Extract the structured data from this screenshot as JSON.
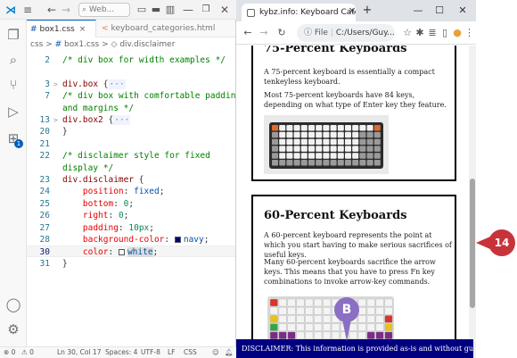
{
  "vscode": {
    "title_search": "Web...",
    "tabs": [
      {
        "icon": "#",
        "label": "box1.css",
        "close": "×"
      },
      {
        "icon": "<",
        "label": "keyboard_categories.html"
      }
    ],
    "breadcrumbs": {
      "folder": "css",
      "sep": ">",
      "file_icon": "#",
      "file": "box1.css",
      "sym_icon": "◇",
      "symbol": "div.disclaimer"
    },
    "extensions_badge": "1",
    "editor_lines": [
      {
        "n": "2",
        "fold": "",
        "tokens": [
          {
            "t": "/* div box for width examples */",
            "c": "comment"
          }
        ]
      },
      {
        "n": "",
        "fold": "",
        "tokens": []
      },
      {
        "n": "3",
        "fold": ">",
        "tokens": [
          {
            "t": "div.box",
            "c": "sel"
          },
          {
            "t": " {",
            "c": "punc"
          },
          {
            "t": "···",
            "c": "ellip"
          }
        ]
      },
      {
        "n": "7",
        "fold": "",
        "tokens": [
          {
            "t": "/* div box with comfortable padding",
            "c": "comment"
          }
        ]
      },
      {
        "n": "",
        "fold": "",
        "tokens": [
          {
            "t": "and margins */",
            "c": "comment"
          }
        ]
      },
      {
        "n": "13",
        "fold": ">",
        "tokens": [
          {
            "t": "div.box2",
            "c": "sel"
          },
          {
            "t": " {",
            "c": "punc"
          },
          {
            "t": "···",
            "c": "ellip"
          }
        ]
      },
      {
        "n": "20",
        "fold": "",
        "tokens": [
          {
            "t": "}",
            "c": "punc"
          }
        ]
      },
      {
        "n": "21",
        "fold": "",
        "tokens": []
      },
      {
        "n": "22",
        "fold": "",
        "tokens": [
          {
            "t": "/* disclaimer style for fixed",
            "c": "comment"
          }
        ]
      },
      {
        "n": "",
        "fold": "",
        "tokens": [
          {
            "t": "display */",
            "c": "comment"
          }
        ]
      },
      {
        "n": "23",
        "fold": "",
        "tokens": [
          {
            "t": "div.disclaimer",
            "c": "sel"
          },
          {
            "t": " {",
            "c": "punc"
          }
        ]
      },
      {
        "n": "24",
        "fold": "",
        "tokens": [
          {
            "t": "    position",
            "c": "prop"
          },
          {
            "t": ": ",
            "c": "punc"
          },
          {
            "t": "fixed",
            "c": "val"
          },
          {
            "t": ";",
            "c": "punc"
          }
        ]
      },
      {
        "n": "25",
        "fold": "",
        "tokens": [
          {
            "t": "    bottom",
            "c": "prop"
          },
          {
            "t": ": ",
            "c": "punc"
          },
          {
            "t": "0",
            "c": "num"
          },
          {
            "t": ";",
            "c": "punc"
          }
        ]
      },
      {
        "n": "26",
        "fold": "",
        "tokens": [
          {
            "t": "    right",
            "c": "prop"
          },
          {
            "t": ": ",
            "c": "punc"
          },
          {
            "t": "0",
            "c": "num"
          },
          {
            "t": ";",
            "c": "punc"
          }
        ]
      },
      {
        "n": "27",
        "fold": "",
        "tokens": [
          {
            "t": "    padding",
            "c": "prop"
          },
          {
            "t": ": ",
            "c": "punc"
          },
          {
            "t": "10px",
            "c": "num"
          },
          {
            "t": ";",
            "c": "punc"
          }
        ]
      },
      {
        "n": "28",
        "fold": "",
        "tokens": [
          {
            "t": "    background-color",
            "c": "prop"
          },
          {
            "t": ": ",
            "c": "punc"
          },
          {
            "t": "navy",
            "c": "val",
            "swatch": "#000080"
          },
          {
            "t": ";",
            "c": "punc"
          }
        ]
      },
      {
        "n": "30",
        "fold": "",
        "current": true,
        "tokens": [
          {
            "t": "    color",
            "c": "prop"
          },
          {
            "t": ": ",
            "c": "punc"
          },
          {
            "t": "white",
            "c": "val",
            "swatch": "#ffffff",
            "selected": true
          },
          {
            "t": ";",
            "c": "punc"
          }
        ]
      },
      {
        "n": "31",
        "fold": "",
        "tokens": [
          {
            "t": "}",
            "c": "punc"
          }
        ]
      }
    ],
    "status": {
      "errors": "0",
      "warnings": "0",
      "position": "Ln 30, Col 17",
      "spaces": "Spaces: 4",
      "encoding": "UTF-8",
      "eol": "LF",
      "language": "CSS"
    }
  },
  "browser": {
    "tab_title": "kybz.info: Keyboard Categories",
    "tab_close": "×",
    "new_tab": "+",
    "win_controls": {
      "minimize": "—",
      "maximize": "☐",
      "close": "✕"
    },
    "address_scheme": "File",
    "address": "C:/Users/Guy...",
    "sections": [
      {
        "heading": "75-Percent Keyboards",
        "paragraphs": [
          "A 75-percent keyboard is essentially a compact tenkeyless keyboard.",
          "Most 75-percent keyboards have 84 keys, depending on what type of Enter key they feature."
        ]
      },
      {
        "heading": "60-Percent Keyboards",
        "paragraphs": [
          "A 60-percent keyboard represents the point at which you start having to make serious sacrifices of useful keys.",
          "Many 60-percent keyboards sacrifice the arrow keys. This means that you have to press Fn key combinations to invoke arrow-key commands."
        ]
      }
    ],
    "disclaimer": "DISCLAIMER: This information is provided as-is and without guarantee."
  },
  "callouts": {
    "b": "B",
    "step": "14"
  }
}
